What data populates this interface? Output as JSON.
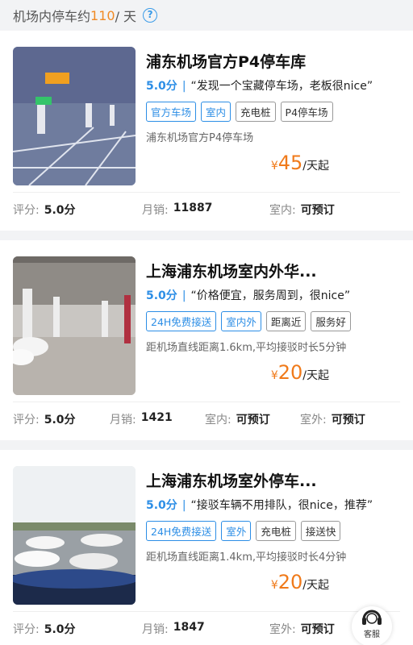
{
  "header": {
    "prefix": "机场内停车约",
    "price": "110",
    "suffix": " / 天",
    "help_icon": "?"
  },
  "listings": [
    {
      "title": "浦东机场官方P4停车库",
      "score": "5.0分",
      "separator": "|",
      "quote": "“发现一个宝藏停车场，老板很nice”",
      "tags": [
        {
          "text": "官方车场",
          "style": "blue"
        },
        {
          "text": "室内",
          "style": "blue"
        },
        {
          "text": "充电桩",
          "style": "gray"
        },
        {
          "text": "P4停车场",
          "style": "gray"
        }
      ],
      "description": "浦东机场官方P4停车场",
      "price_symbol": "¥",
      "price_value": "45",
      "price_unit": "/天起",
      "footer": [
        {
          "label": "评分:",
          "value": "5.0分"
        },
        {
          "label": "月销:",
          "value": "11887"
        },
        {
          "label": "室内:",
          "value": "可预订"
        }
      ]
    },
    {
      "title": "上海浦东机场室内外华...",
      "score": "5.0分",
      "separator": "|",
      "quote": "“价格便宜，服务周到，很nice”",
      "tags": [
        {
          "text": "24H免费接送",
          "style": "blue"
        },
        {
          "text": "室内外",
          "style": "blue"
        },
        {
          "text": "距离近",
          "style": "gray"
        },
        {
          "text": "服务好",
          "style": "gray"
        }
      ],
      "description": "距机场直线距离1.6km,平均接驳时长5分钟",
      "price_symbol": "¥",
      "price_value": "20",
      "price_unit": "/天起",
      "footer": [
        {
          "label": "评分:",
          "value": "5.0分"
        },
        {
          "label": "月销:",
          "value": "1421"
        },
        {
          "label": "室内:",
          "value": "可预订"
        },
        {
          "label": "室外:",
          "value": "可预订"
        }
      ]
    },
    {
      "title": "上海浦东机场室外停车...",
      "score": "5.0分",
      "separator": "|",
      "quote": "“接驳车辆不用排队，很nice，推荐”",
      "tags": [
        {
          "text": "24H免费接送",
          "style": "blue"
        },
        {
          "text": "室外",
          "style": "blue"
        },
        {
          "text": "充电桩",
          "style": "gray"
        },
        {
          "text": "接送快",
          "style": "gray"
        }
      ],
      "description": "距机场直线距离1.4km,平均接驳时长4分钟",
      "price_symbol": "¥",
      "price_value": "20",
      "price_unit": "/天起",
      "footer": [
        {
          "label": "评分:",
          "value": "5.0分"
        },
        {
          "label": "月销:",
          "value": "1847"
        },
        {
          "label": "室外:",
          "value": "可预订"
        }
      ]
    }
  ],
  "customer_service": {
    "label": "客服",
    "icon": "headset-icon"
  },
  "colors": {
    "accent_blue": "#2c8ee6",
    "price_orange": "#f07a1a",
    "header_price": "#f08a24"
  }
}
